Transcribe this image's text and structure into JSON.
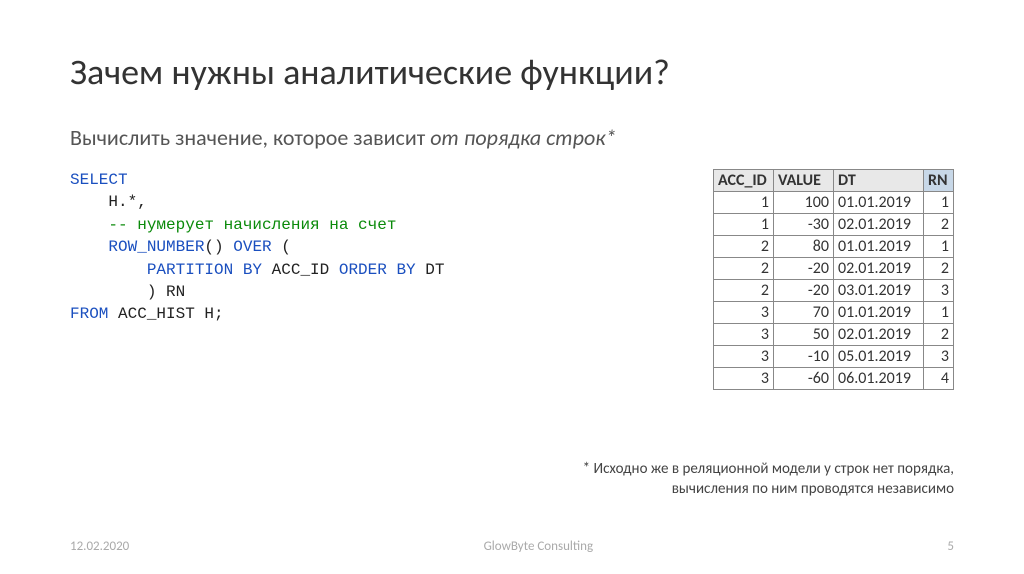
{
  "title": "Зачем нужны аналитические функции?",
  "subtitle_prefix": "Вычислить значение, которое зависит ",
  "subtitle_emph": "от порядка строк*",
  "code": {
    "kw_select": "SELECT",
    "l2": "    H.*,",
    "cmt": "    -- нумерует начисления на счет",
    "l4a": "    ",
    "l4_rownum": "ROW_NUMBER",
    "l4b": "() ",
    "l4_over": "OVER",
    "l4c": " (",
    "l5a": "        ",
    "l5_part": "PARTITION BY",
    "l5b": " ACC_ID ",
    "l5_ord": "ORDER BY",
    "l5c": " DT",
    "l6": "        ) RN",
    "kw_from": "FROM",
    "l7b": " ACC_HIST H;"
  },
  "table": {
    "headers": {
      "acc": "ACC_ID",
      "val": "VALUE",
      "dt": "DT",
      "rn": "RN"
    },
    "rows": [
      {
        "acc": "1",
        "val": "100",
        "dt": "01.01.2019",
        "rn": "1"
      },
      {
        "acc": "1",
        "val": "-30",
        "dt": "02.01.2019",
        "rn": "2"
      },
      {
        "acc": "2",
        "val": "80",
        "dt": "01.01.2019",
        "rn": "1"
      },
      {
        "acc": "2",
        "val": "-20",
        "dt": "02.01.2019",
        "rn": "2"
      },
      {
        "acc": "2",
        "val": "-20",
        "dt": "03.01.2019",
        "rn": "3"
      },
      {
        "acc": "3",
        "val": "70",
        "dt": "01.01.2019",
        "rn": "1"
      },
      {
        "acc": "3",
        "val": "50",
        "dt": "02.01.2019",
        "rn": "2"
      },
      {
        "acc": "3",
        "val": "-10",
        "dt": "05.01.2019",
        "rn": "3"
      },
      {
        "acc": "3",
        "val": "-60",
        "dt": "06.01.2019",
        "rn": "4"
      }
    ]
  },
  "footnote": "* Исходно же в реляционной модели у строк нет порядка, вычисления по ним проводятся независимо",
  "footer": {
    "date": "12.02.2020",
    "org": "GlowByte Consulting",
    "page": "5"
  }
}
